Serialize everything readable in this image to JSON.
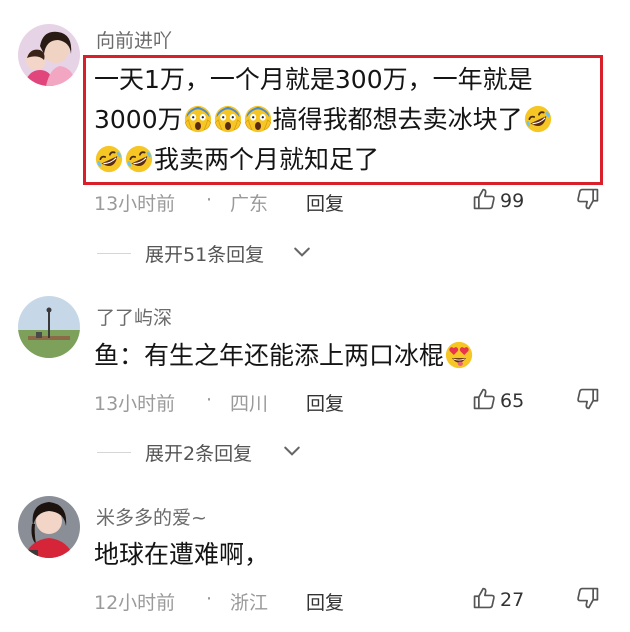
{
  "comments": [
    {
      "username": "向前进吖",
      "lines": [
        {
          "text": "一天1万，一个月就是300万，一年就是"
        },
        {
          "before": "3000万",
          "after": "搞得我都想去卖冰块了"
        },
        {
          "after": "我卖两个月就知足了"
        }
      ],
      "time": "13小时前",
      "separator": "·",
      "location": "广东",
      "reply_label": "回复",
      "likes": "99",
      "expand_label": "展开51条回复"
    },
    {
      "username": "了了屿深",
      "text": "鱼：有生之年还能添上两口冰棍",
      "time": "13小时前",
      "separator": "·",
      "location": "四川",
      "reply_label": "回复",
      "likes": "65",
      "expand_label": "展开2条回复"
    },
    {
      "username": "米多多的爱~",
      "text": "地球在遭难啊，",
      "time": "12小时前",
      "separator": "·",
      "location": "浙江",
      "reply_label": "回复",
      "likes": "27"
    }
  ],
  "icons": {
    "scream": "face-screaming-in-fear-icon",
    "rofl": "rolling-on-floor-laughing-icon",
    "heart_eyes": "smiling-face-with-heart-eyes-icon",
    "like": "thumbs-up-outline-icon",
    "dislike": "thumbs-down-outline-icon",
    "chevron": "chevron-down-icon"
  },
  "colors": {
    "highlight_border": "#d9202a",
    "meta_text": "#9a9a9a",
    "username_text": "#6b6b6b"
  }
}
